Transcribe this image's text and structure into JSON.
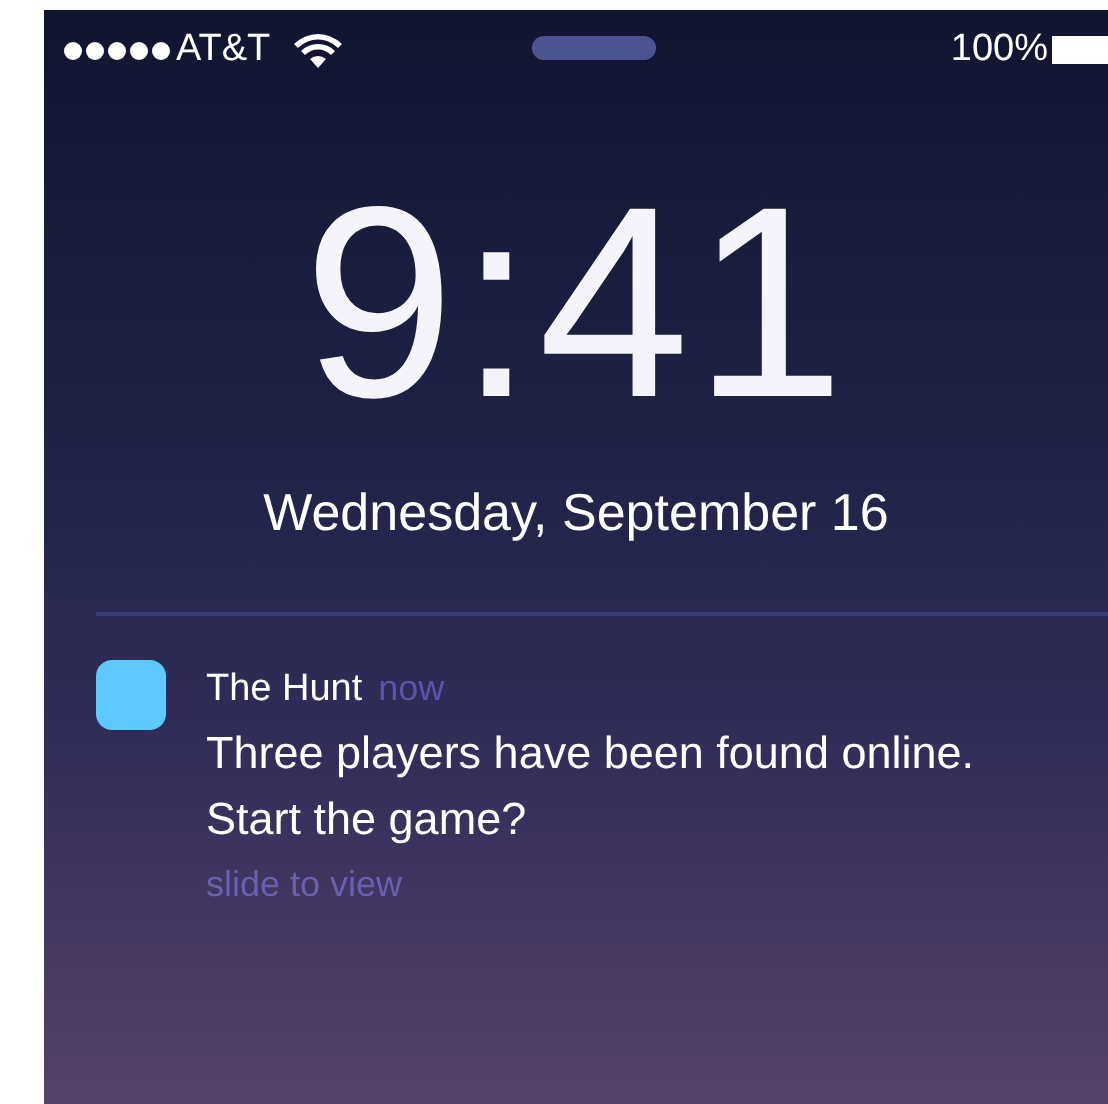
{
  "status_bar": {
    "carrier": "AT&T",
    "battery": "100%"
  },
  "lock_screen": {
    "time": "9:41",
    "date": "Wednesday, September 16"
  },
  "notification": {
    "app": "The Hunt",
    "time": "now",
    "message": "Three players have been found online. Start the game?",
    "action": "slide to view"
  }
}
